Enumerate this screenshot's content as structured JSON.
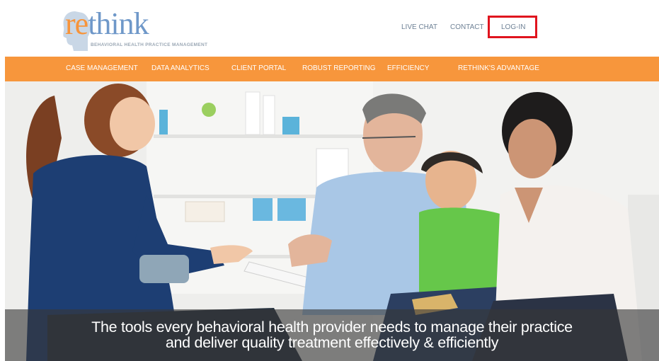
{
  "brand": {
    "name_prefix": "re",
    "name_suffix": "think",
    "tagline": "BEHAVIORAL HEALTH PRACTICE MANAGEMENT",
    "colors": {
      "orange": "#f7963c",
      "blue": "#6f98c9",
      "highlight": "#e0141e"
    }
  },
  "top_links": {
    "live_chat": "LIVE CHAT",
    "contact": "CONTACT",
    "login": "LOG-IN"
  },
  "nav": {
    "items": [
      {
        "label": "CASE MANAGEMENT"
      },
      {
        "label": "DATA ANALYTICS"
      },
      {
        "label": "CLIENT PORTAL"
      },
      {
        "label": "ROBUST REPORTING"
      },
      {
        "label": "EFFICIENCY"
      },
      {
        "label": "RETHINK'S ADVANTAGE"
      }
    ]
  },
  "hero": {
    "caption_line1": "The tools every behavioral health provider needs to manage their practice",
    "caption_line2": "and deliver quality treatment effectively & efficiently"
  }
}
